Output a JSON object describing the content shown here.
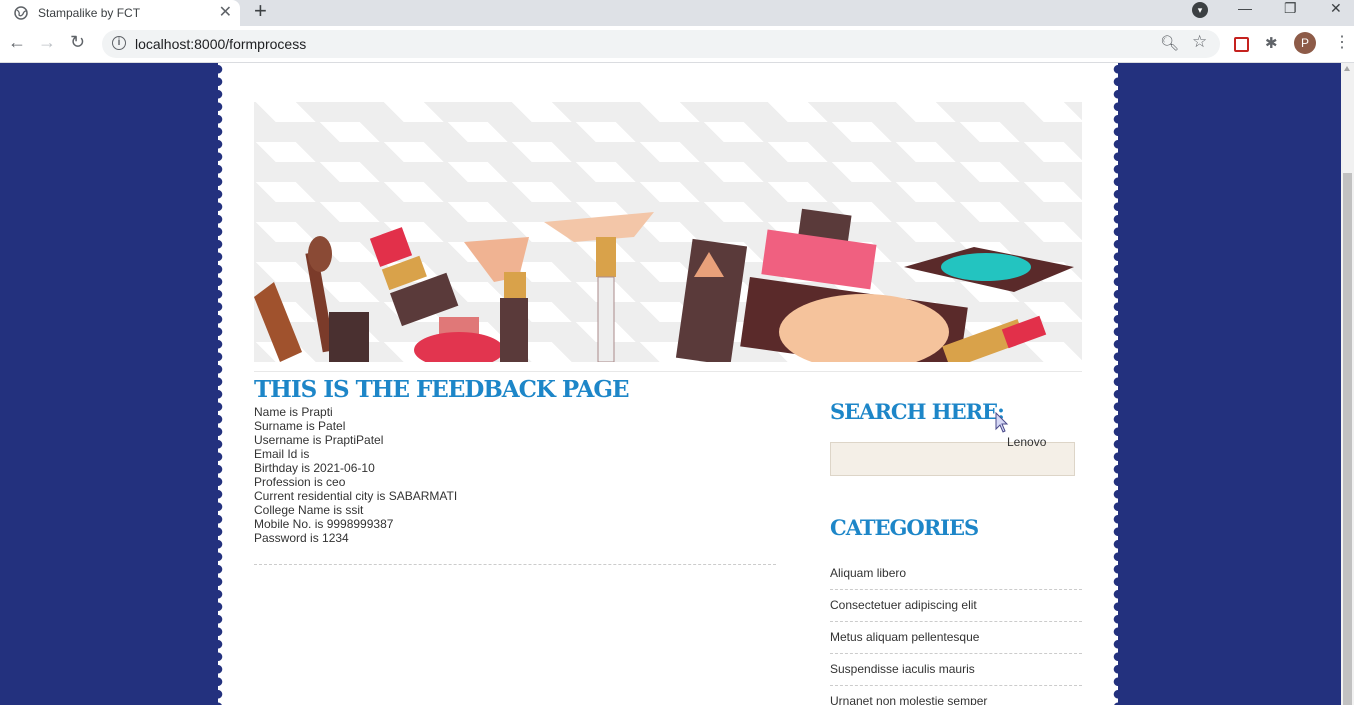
{
  "browser": {
    "tab_title": "Stampalike by FCT",
    "new_tab": "+",
    "url": "localhost:8000/formprocess",
    "avatar_letter": "P",
    "window_controls": [
      "—",
      "❐",
      "✕"
    ]
  },
  "page": {
    "heading": "THIS IS THE FEEDBACK PAGE",
    "feedback_lines": [
      "Name is Prapti",
      "Surname is Patel",
      "Username is PraptiPatel",
      "Email Id is",
      "Birthday is 2021-06-10",
      "Profession is ceo",
      "Current residential city is SABARMATI",
      "College Name is ssit",
      "Mobile No. is 9998999387",
      "Password is 1234"
    ]
  },
  "sidebar": {
    "search_heading": "SEARCH HERE:",
    "search_value": "",
    "autofill_tooltip": "Lenovo",
    "categories_heading": "CATEGORIES",
    "categories": [
      "Aliquam libero",
      "Consectetuer adipiscing elit",
      "Metus aliquam pellentesque",
      "Suspendisse iaculis mauris",
      "Urnanet non molestie semper"
    ]
  },
  "colors": {
    "background": "#23317e",
    "heading": "#1d86c8",
    "search_field": "#f4efe7"
  }
}
